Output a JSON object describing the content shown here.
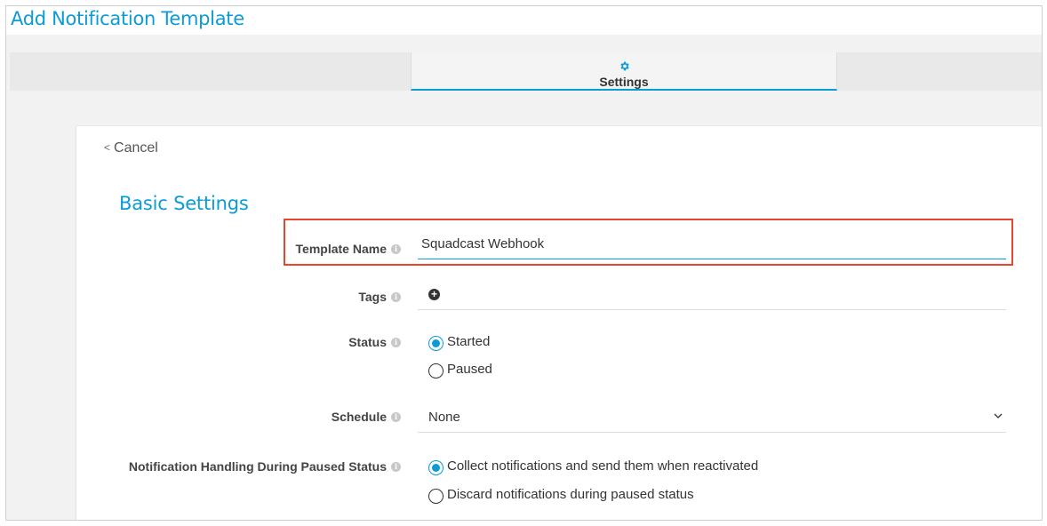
{
  "page": {
    "title": "Add Notification Template"
  },
  "tabs": [
    {
      "label": "Settings",
      "icon": "gear-icon",
      "active": true
    }
  ],
  "cancel": {
    "label": "Cancel"
  },
  "section": {
    "title": "Basic Settings"
  },
  "form": {
    "template_name": {
      "label": "Template Name",
      "value": "Squadcast Webhook"
    },
    "tags": {
      "label": "Tags"
    },
    "status": {
      "label": "Status",
      "options": [
        "Started",
        "Paused"
      ],
      "selected": "Started"
    },
    "schedule": {
      "label": "Schedule",
      "value": "None"
    },
    "paused_handling": {
      "label": "Notification Handling During Paused Status",
      "options": [
        "Collect notifications and send them when reactivated",
        "Discard notifications during paused status"
      ],
      "selected": "Collect notifications and send them when reactivated"
    }
  },
  "colors": {
    "accent": "#0b9bd6",
    "highlight": "#e8462c"
  }
}
